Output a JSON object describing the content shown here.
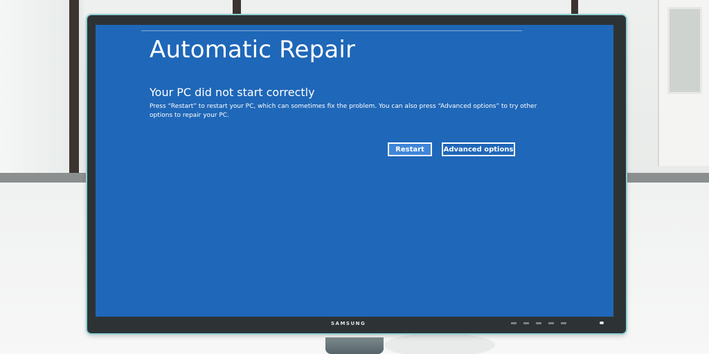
{
  "screen": {
    "title": "Automatic Repair",
    "subtitle": "Your PC did not start correctly",
    "message": "Press “Restart” to restart your PC, which can sometimes fix the problem. You can also press “Advanced options” to try other options to repair your PC.",
    "buttons": {
      "restart_label": "Restart",
      "advanced_label": "Advanced options"
    }
  },
  "monitor": {
    "brand": "SAMSUNG"
  },
  "colors": {
    "screen_background": "#1f67b8",
    "primary_button": "#3f86d8",
    "text": "#ffffff",
    "bezel": "#2d3335",
    "bezel_edge": "#8fd0d6"
  },
  "icons": {
    "power": "power-indicator-icon"
  }
}
